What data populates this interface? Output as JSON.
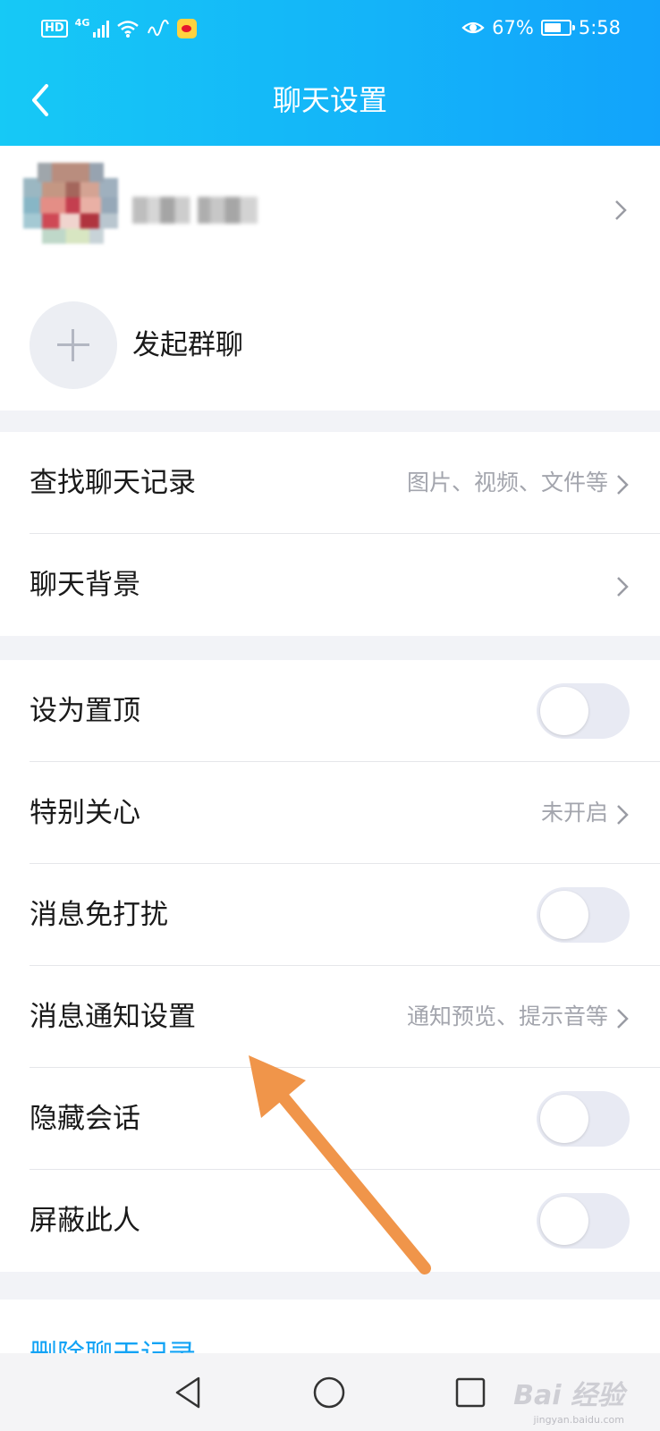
{
  "status_bar": {
    "hd": "HD",
    "network": "4G",
    "battery_percent": "67%",
    "time": "5:58",
    "icons": [
      "hd-icon",
      "signal-icon",
      "wifi-icon",
      "weibo-icon",
      "eye-icon",
      "battery-icon"
    ]
  },
  "header": {
    "title": "聊天设置",
    "back_icon": "back-arrow-icon",
    "background": [
      "#16c9f6",
      "#12a3fb"
    ]
  },
  "contact": {
    "chevron_icon": "chevron-right-icon"
  },
  "group_chat": {
    "label": "发起群聊",
    "icon": "plus-icon"
  },
  "section1": {
    "search_history": {
      "label": "查找聊天记录",
      "hint": "图片、视频、文件等"
    },
    "chat_background": {
      "label": "聊天背景"
    }
  },
  "section2": {
    "pin_top": {
      "label": "设为置顶",
      "on": false
    },
    "special_care": {
      "label": "特别关心",
      "hint": "未开启"
    },
    "do_not_disturb": {
      "label": "消息免打扰",
      "on": false
    },
    "notification_settings": {
      "label": "消息通知设置",
      "hint": "通知预览、提示音等"
    },
    "hide_conversation": {
      "label": "隐藏会话",
      "on": false
    },
    "block_user": {
      "label": "屏蔽此人",
      "on": false
    }
  },
  "delete": {
    "label": "删除聊天记录"
  },
  "navbar": {
    "icons": [
      "nav-back-icon",
      "nav-home-icon",
      "nav-recents-icon"
    ]
  },
  "watermark": {
    "text": "Bai 经验",
    "sub": "jingyan.baidu.com"
  },
  "colors": {
    "accent": "#12a3f5",
    "annotation_arrow": "#f0954a"
  }
}
